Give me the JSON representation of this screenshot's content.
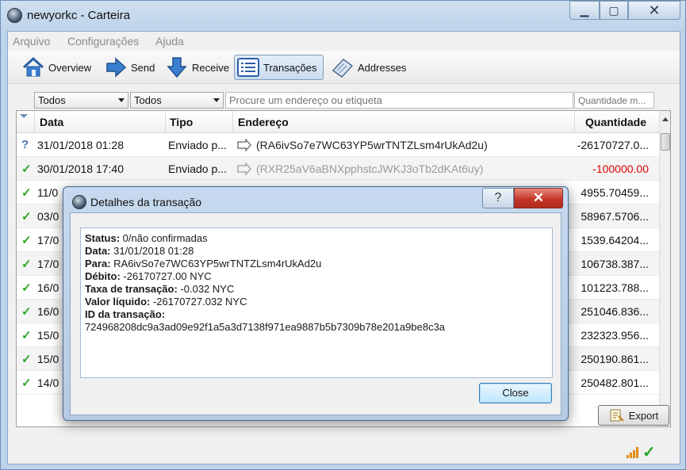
{
  "window": {
    "title": "newyorkc - Carteira"
  },
  "menu": [
    "Arquivo",
    "Configurações",
    "Ajuda"
  ],
  "toolbar": {
    "overview": "Overview",
    "send": "Send",
    "receive": "Receive",
    "transactions": "Transações",
    "addresses": "Addresses"
  },
  "filters": {
    "date_filter": "Todos",
    "type_filter": "Todos",
    "search_placeholder": "Procure um endereço ou etiqueta",
    "amount_placeholder": "Quantidade m..."
  },
  "table": {
    "headers": {
      "date": "Data",
      "type": "Tipo",
      "address": "Endereço",
      "amount": "Quantidade"
    },
    "rows": [
      {
        "status": "?",
        "date": "31/01/2018 01:28",
        "type": "Enviado p...",
        "address": "(RA6ivSo7e7WC63YP5wrTNTZLsm4rUkAd2u)",
        "amount": "-26170727.0..."
      },
      {
        "status": "✓",
        "date": "30/01/2018 17:40",
        "type": "Enviado p...",
        "address": "(RXR25aV6aBNXpphstcJWKJ3oTb2dKAt6uy)",
        "amount": "-100000.00"
      },
      {
        "status": "✓",
        "date": "11/0",
        "type": "",
        "address": "",
        "amount": "4955.70459..."
      },
      {
        "status": "✓",
        "date": "03/0",
        "type": "",
        "address": "",
        "amount": "58967.5706..."
      },
      {
        "status": "✓",
        "date": "17/0",
        "type": "",
        "address": "",
        "amount": "1539.64204..."
      },
      {
        "status": "✓",
        "date": "17/0",
        "type": "",
        "address": "",
        "amount": "106738.387..."
      },
      {
        "status": "✓",
        "date": "16/0",
        "type": "",
        "address": "",
        "amount": "101223.788..."
      },
      {
        "status": "✓",
        "date": "16/0",
        "type": "",
        "address": "",
        "amount": "251046.836..."
      },
      {
        "status": "✓",
        "date": "15/0",
        "type": "",
        "address": "",
        "amount": "232323.956..."
      },
      {
        "status": "✓",
        "date": "15/0",
        "type": "",
        "address": "",
        "amount": "250190.861..."
      },
      {
        "status": "✓",
        "date": "14/0",
        "type": "",
        "address": "",
        "amount": "250482.801..."
      }
    ]
  },
  "export": "Export",
  "dialog": {
    "title": "Detalhes da transação",
    "help": "?",
    "close_x": "✕",
    "lines": [
      {
        "label": "Status:",
        "value": " 0/não confirmadas"
      },
      {
        "label": "Data:",
        "value": " 31/01/2018 01:28"
      },
      {
        "label": "Para:",
        "value": " RA6ivSo7e7WC63YP5wrTNTZLsm4rUkAd2u"
      },
      {
        "label": "Débito:",
        "value": " -26170727.00 NYC"
      },
      {
        "label": "Taxa de transação:",
        "value": " -0.032 NYC"
      },
      {
        "label": "Valor líquido:",
        "value": " -26170727.032 NYC"
      },
      {
        "label": "ID da transação:",
        "value": ""
      }
    ],
    "txid": "724968208dc9a3ad09e92f1a5a3d7138f971ea9887b5b7309b78e201a9be8c3a",
    "close_button": "Close"
  },
  "colors": {
    "negative": "#e00000",
    "confirmed": "#2aa52a"
  }
}
